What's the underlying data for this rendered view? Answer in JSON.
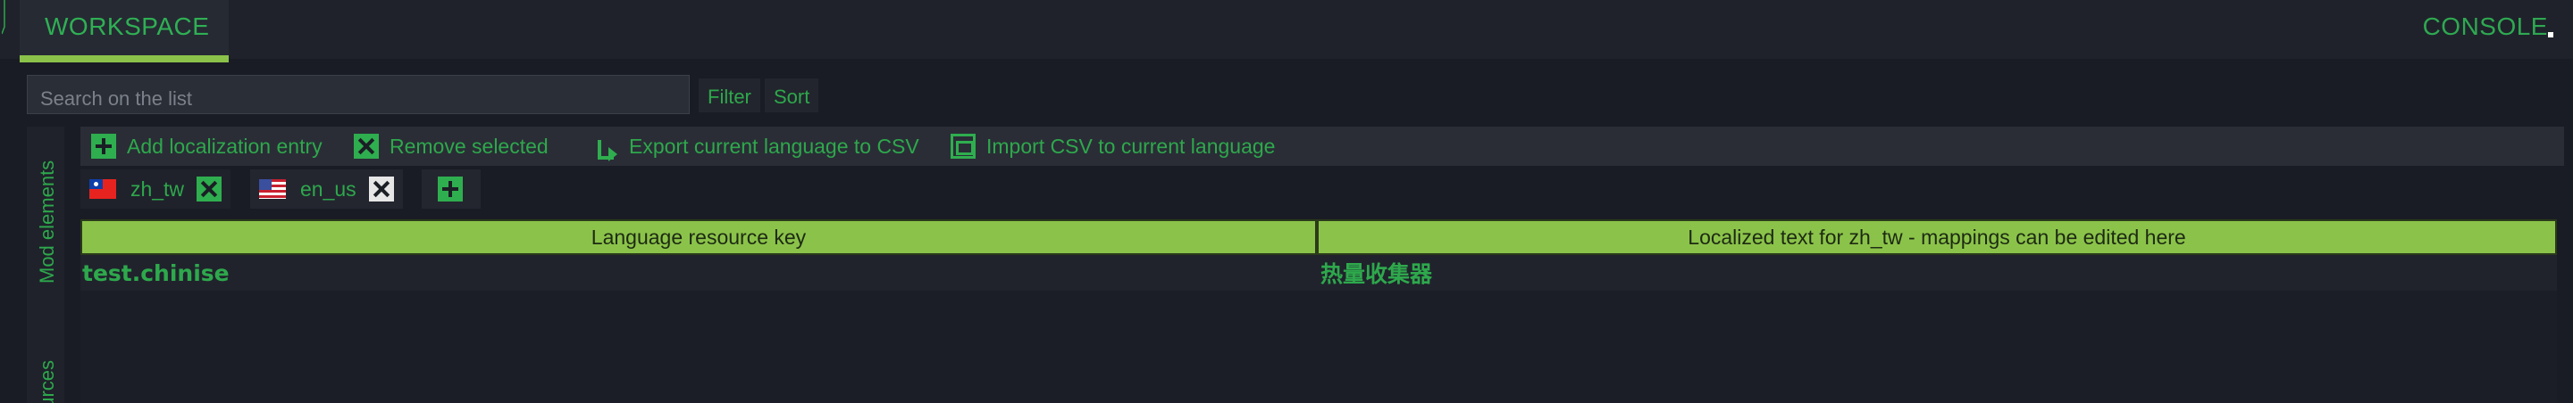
{
  "header": {
    "workspace_tab": "WORKSPACE",
    "console_tab": "CONSOLE"
  },
  "search": {
    "placeholder": "Search on the list",
    "filter_label": "Filter",
    "sort_label": "Sort"
  },
  "side_panel": {
    "items": [
      {
        "label": "Mod elements"
      },
      {
        "label": "ources"
      }
    ]
  },
  "toolbar": {
    "add_entry": "Add localization entry",
    "remove_selected": "Remove selected",
    "export_csv": "Export current language to CSV",
    "import_csv": "Import CSV to current language"
  },
  "languages": {
    "tabs": [
      {
        "code": "zh_tw",
        "flag": "taiwan-flag",
        "active": true
      },
      {
        "code": "en_us",
        "flag": "us-flag",
        "active": false
      }
    ]
  },
  "table": {
    "columns": [
      "Language resource key",
      "Localized text for zh_tw - mappings can be edited here"
    ],
    "rows": [
      {
        "key": "test.chinise",
        "value": "热量收集器"
      }
    ]
  },
  "colors": {
    "accent_green": "#2ea84c",
    "header_green": "#8bc34a",
    "background": "#191c24"
  }
}
